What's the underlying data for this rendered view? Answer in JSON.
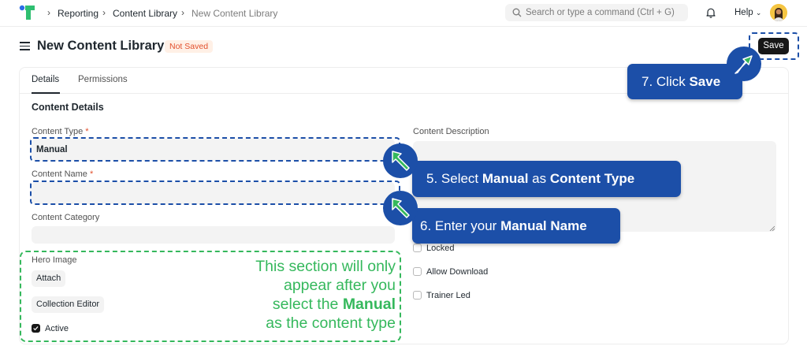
{
  "topbar": {
    "breadcrumbs": [
      "Reporting",
      "Content Library",
      "New Content Library"
    ],
    "search_placeholder": "Search or type a command (Ctrl + G)",
    "help_label": "Help"
  },
  "header": {
    "title": "New Content Library",
    "status": "Not Saved",
    "save_label": "Save"
  },
  "tabs": [
    "Details",
    "Permissions"
  ],
  "section_title": "Content Details",
  "form": {
    "content_type_label": "Content Type",
    "content_type_value": "Manual",
    "content_name_label": "Content Name",
    "content_name_value": "",
    "content_category_label": "Content Category",
    "content_description_label": "Content Description",
    "hero_image_label": "Hero Image",
    "attach_label": "Attach",
    "collection_editor_label": "Collection Editor",
    "active_label": "Active",
    "locked_label": "Locked",
    "allow_download_label": "Allow Download",
    "trainer_led_label": "Trainer Led",
    "required_mark": "*"
  },
  "annotations": {
    "step5_prefix": "5. Select ",
    "step5_bold1": "Manual",
    "step5_mid": " as ",
    "step5_bold2": "Content Type",
    "step6_prefix": "6. Enter your ",
    "step6_bold": "Manual Name",
    "step7_prefix": "7. Click ",
    "step7_bold": "Save",
    "note_line1": "This section will only",
    "note_line2": "appear after you",
    "note_line3_prefix": "select the ",
    "note_line3_bold": "Manual",
    "note_line4": "as the content type"
  },
  "colors": {
    "annotation_blue": "#1c4fa8",
    "annotation_green": "#35b85c",
    "status_orange": "#e2502d",
    "primary_button": "#171717"
  },
  "icons": [
    "app-logo-icon",
    "chevron-right-icon",
    "search-icon",
    "bell-icon",
    "chevron-down-icon",
    "hamburger-icon",
    "cursor-arrow-icon",
    "checkmark-icon",
    "resize-handle-icon"
  ]
}
